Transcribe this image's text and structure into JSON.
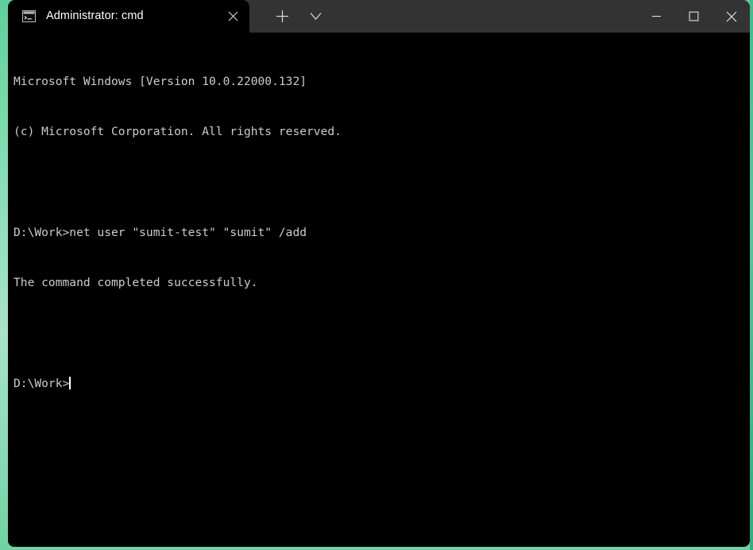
{
  "window": {
    "title": "Administrator: cmd",
    "app": "Windows Terminal",
    "background_color": "#000000",
    "titlebar_color": "#333333",
    "desktop_accent_color": "#7ddcb0"
  },
  "titlebar": {
    "tabs": [
      {
        "label": "Administrator: cmd",
        "icon": "cmd-console-icon",
        "active": true,
        "close_label": "✕"
      }
    ],
    "new_tab_label": "＋",
    "dropdown_label": "⌄",
    "minimize_label": "─",
    "maximize_label": "□",
    "close_label": "✕"
  },
  "terminal": {
    "foreground_color": "#cccccc",
    "cursor_color": "#ffffff",
    "lines": [
      "Microsoft Windows [Version 10.0.22000.132]",
      "(c) Microsoft Corporation. All rights reserved.",
      "",
      "D:\\Work>net user \"sumit-test\" \"sumit\" /add",
      "The command completed successfully.",
      "",
      ""
    ],
    "prompt": "D:\\Work>",
    "input_value": ""
  }
}
